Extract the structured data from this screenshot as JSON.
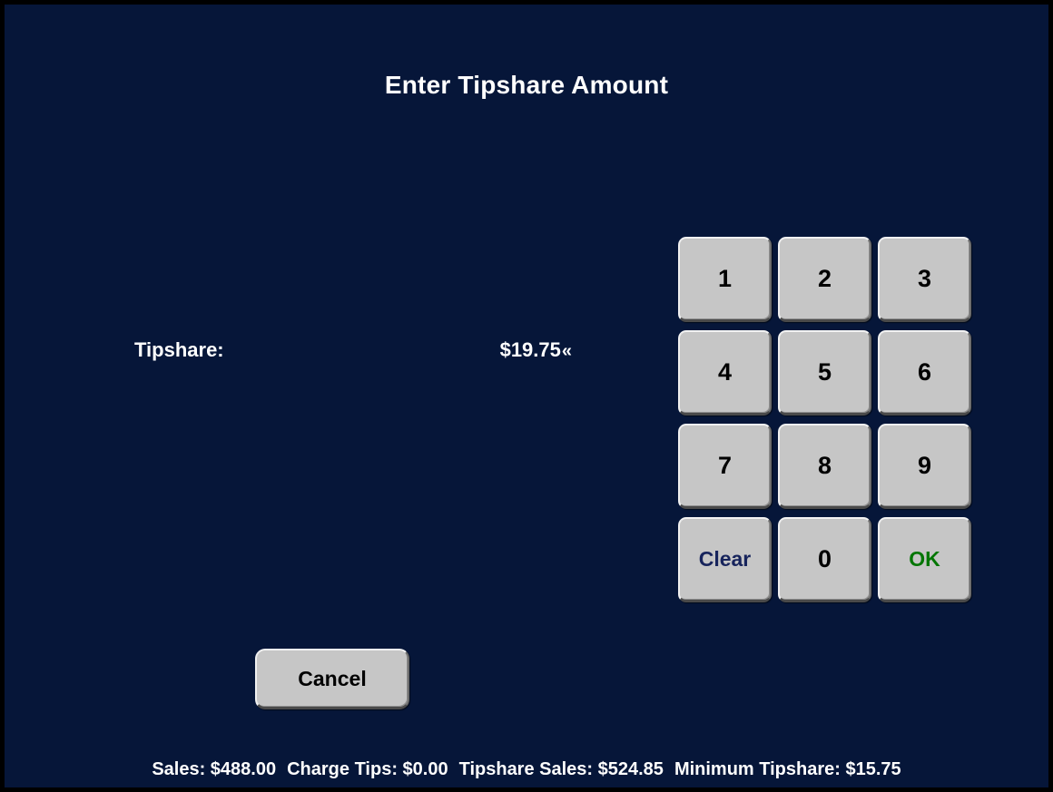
{
  "window": {
    "title": "Enter Tipshare Amount",
    "background_color": "#061639",
    "frame_color": "#000000"
  },
  "field": {
    "label": "Tipshare:",
    "value": "$19.75",
    "caret_marker": "«"
  },
  "keypad": {
    "keys": [
      {
        "label": "1",
        "name": "key-1",
        "style": "digit"
      },
      {
        "label": "2",
        "name": "key-2",
        "style": "digit"
      },
      {
        "label": "3",
        "name": "key-3",
        "style": "digit"
      },
      {
        "label": "4",
        "name": "key-4",
        "style": "digit"
      },
      {
        "label": "5",
        "name": "key-5",
        "style": "digit"
      },
      {
        "label": "6",
        "name": "key-6",
        "style": "digit"
      },
      {
        "label": "7",
        "name": "key-7",
        "style": "digit"
      },
      {
        "label": "8",
        "name": "key-8",
        "style": "digit"
      },
      {
        "label": "9",
        "name": "key-9",
        "style": "digit"
      },
      {
        "label": "Clear",
        "name": "key-clear",
        "style": "blue"
      },
      {
        "label": "0",
        "name": "key-0",
        "style": "digit"
      },
      {
        "label": "OK",
        "name": "key-ok",
        "style": "green"
      }
    ],
    "clear_text_color": "#17245c",
    "ok_text_color": "#047604",
    "digit_text_color": "#000000",
    "face_color": "#c6c6c6"
  },
  "actions": {
    "cancel_label": "Cancel"
  },
  "status": {
    "segments": [
      "Sales: $488.00",
      "Charge Tips: $0.00",
      "Tipshare Sales: $524.85",
      "Minimum Tipshare: $15.75"
    ],
    "sales": "$488.00",
    "charge_tips": "$0.00",
    "tipshare_sales": "$524.85",
    "minimum_tipshare": "$15.75"
  }
}
